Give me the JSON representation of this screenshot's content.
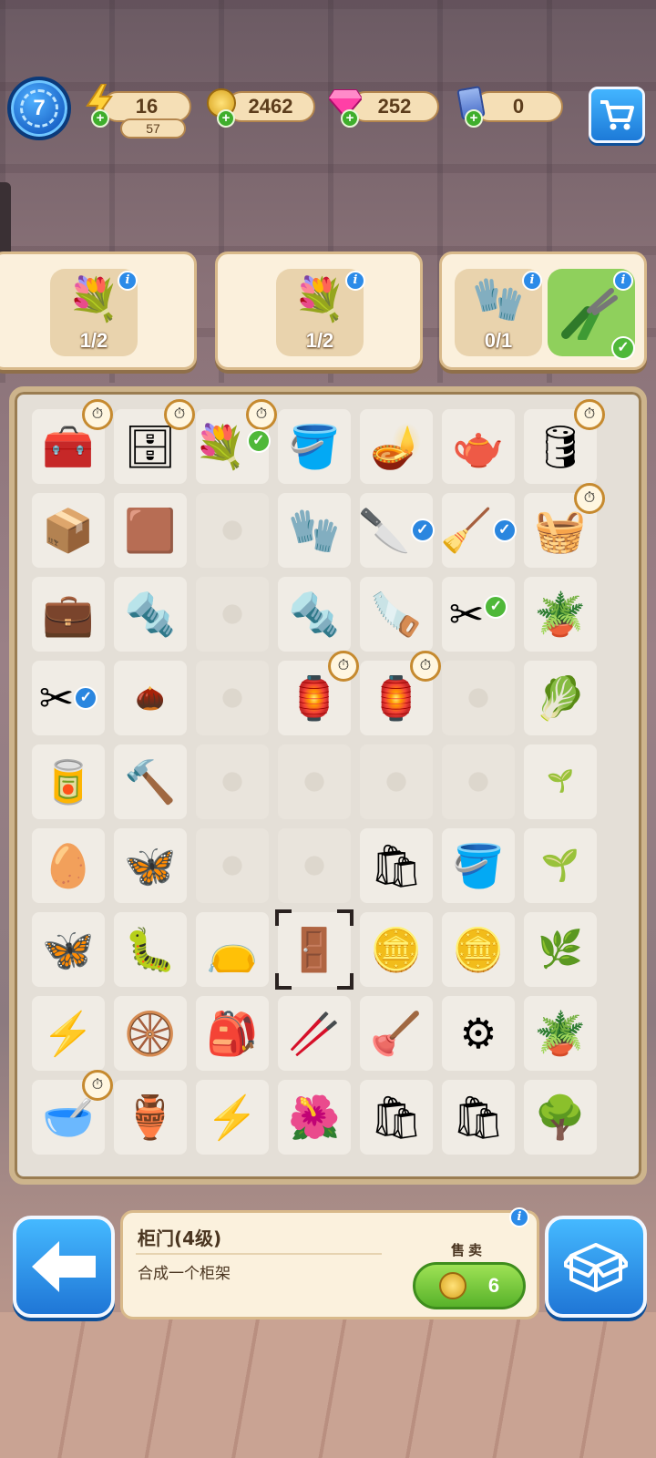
{
  "hud": {
    "level": "7",
    "energy": "16",
    "energy_sub": "57",
    "coins": "2462",
    "gems": "252",
    "cards": "0"
  },
  "orders": [
    {
      "items": [
        {
          "icon": "flower-bush-icon",
          "count": "1/2"
        }
      ]
    },
    {
      "items": [
        {
          "icon": "flower-bush-icon",
          "count": "1/2"
        }
      ]
    },
    {
      "items": [
        {
          "icon": "gloves-icon",
          "count": "0/1"
        },
        {
          "icon": "pliers-icon",
          "count": "",
          "done": true
        }
      ]
    }
  ],
  "board": {
    "rows": [
      [
        "toolbox-icon",
        "drawer-cabinet-icon",
        "flower-bush-icon",
        "paint-bucket-icon",
        "sprinkler-icon",
        "kettle-icon",
        "tool-barrel-icon"
      ],
      [
        "open-box-icon",
        "wooden-crate-icon",
        "",
        "gloves-icon",
        "knife-icon",
        "rake-icon",
        "tool-bucket-icon"
      ],
      [
        "wooden-case-icon",
        "screws-icon",
        "",
        "screw-icon",
        "trowel-icon",
        "pliers-icon",
        "moss-bucket-icon"
      ],
      [
        "garden-shears-icon",
        "seeds-icon",
        "",
        "lantern-icon",
        "lantern-icon",
        "",
        "moss-pot-icon"
      ],
      [
        "paint-can-icon",
        "mallet-icon",
        "",
        "",
        "",
        "",
        "seeds-icon"
      ],
      [
        "eggshells-icon",
        "moth-icon",
        "",
        "",
        "seed-sack-icon",
        "pink-bucket-icon",
        "sprout-icon"
      ],
      [
        "hawk-moth-icon",
        "white-moth-icon",
        "seed-bag-icon",
        "cabinet-door-icon",
        "coin-icon",
        "coins-icon",
        "sapling-icon"
      ],
      [
        "energy-chest-icon",
        "wheel-icon",
        "ub-bag-icon",
        "handle-icon",
        "plunger-icon",
        "tires-icon",
        "pot-sprout-icon"
      ],
      [
        "blue-pot-icon",
        "clay-pot-icon",
        "energy-cabinet-icon",
        "potted-plant-icon",
        "seed-sack-icon",
        "seed-sacks-icon",
        "potted-tree-icon"
      ]
    ]
  },
  "info": {
    "name": "柜门(4级)",
    "description": "合成一个柜架",
    "sell_label": "售卖",
    "sell_price": "6"
  },
  "colors": {
    "accent_blue": "#2c8be8",
    "sell_green": "#58b22a",
    "panel_cream": "#fbf1dd"
  }
}
